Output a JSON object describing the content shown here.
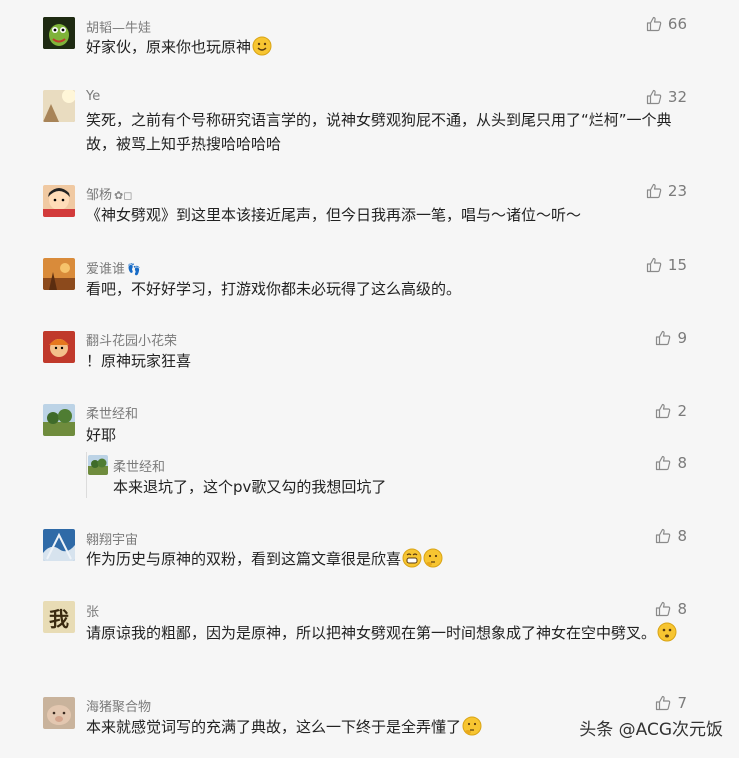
{
  "comments": [
    {
      "name": "胡韬—牛娃",
      "text": "好家伙，原来你也玩原神",
      "likes": "66"
    },
    {
      "name": "Ye",
      "text": "笑死，之前有个号称研究语言学的，说神女劈观狗屁不通，从头到尾只用了“烂柯”一个典故，被骂上知乎热搜哈哈哈哈",
      "likes": "32"
    },
    {
      "name": "邹杨",
      "text": "《神女劈观》到这里本该接近尾声，但今日我再添一笔，唱与～诸位～听～",
      "likes": "23"
    },
    {
      "name": "爱谁谁",
      "text": "看吧，不好好学习，打游戏你都未必玩得了这么高级的。",
      "likes": "15"
    },
    {
      "name": "翻斗花园小花荣",
      "text": "！原神玩家狂喜",
      "likes": "9"
    },
    {
      "name": "柔世经和",
      "text": "好耶",
      "likes": "2"
    },
    {
      "name": "柔世经和",
      "text": "本来退坑了，这个pv歌又勾的我想回坑了",
      "likes": "8"
    },
    {
      "name": "翱翔宇宙",
      "text": "作为历史与原神的双粉，看到这篇文章很是欣喜",
      "likes": "8"
    },
    {
      "name": "张",
      "text": "请原谅我的粗鄙，因为是原神，所以把神女劈观在第一时间想象成了神女在空中劈叉。",
      "likes": "8"
    },
    {
      "name": "海猪聚合物",
      "text": "本来就感觉词写的充满了典故，这么一下终于是全弄懂了",
      "likes": "7"
    }
  ],
  "avatar_glyph_zhang": "我",
  "watermark": "头条 @ACG次元饭"
}
